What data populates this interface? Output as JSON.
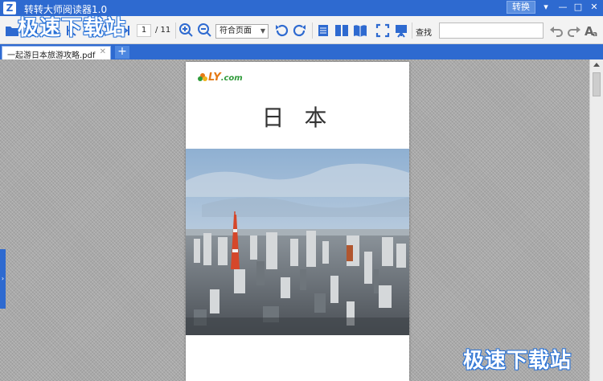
{
  "titlebar": {
    "logo_letter": "Z",
    "title": "转转大师阅读器1.0",
    "convert_label": "转换",
    "menu_glyph": "▾",
    "minimize_glyph": "—",
    "maximize_glyph": "□",
    "close_glyph": "✕"
  },
  "toolbar": {
    "page_current": "1",
    "page_total": "/ 11",
    "zoom_value": "符合页面",
    "find_label": "查找",
    "find_placeholder": ""
  },
  "tabs": [
    {
      "label": "一起游日本旅游攻略.pdf",
      "close": "✕"
    }
  ],
  "add_tab_label": "+",
  "document": {
    "logo_text": "LY",
    "logo_com": ".com",
    "title": "日 本"
  },
  "watermark": "极速下载站",
  "colors": {
    "titlebar": "#2e6ad0",
    "icon_blue": "#2e6ad0",
    "logo_orange": "#e57a14",
    "logo_green": "#2f9b3a"
  }
}
